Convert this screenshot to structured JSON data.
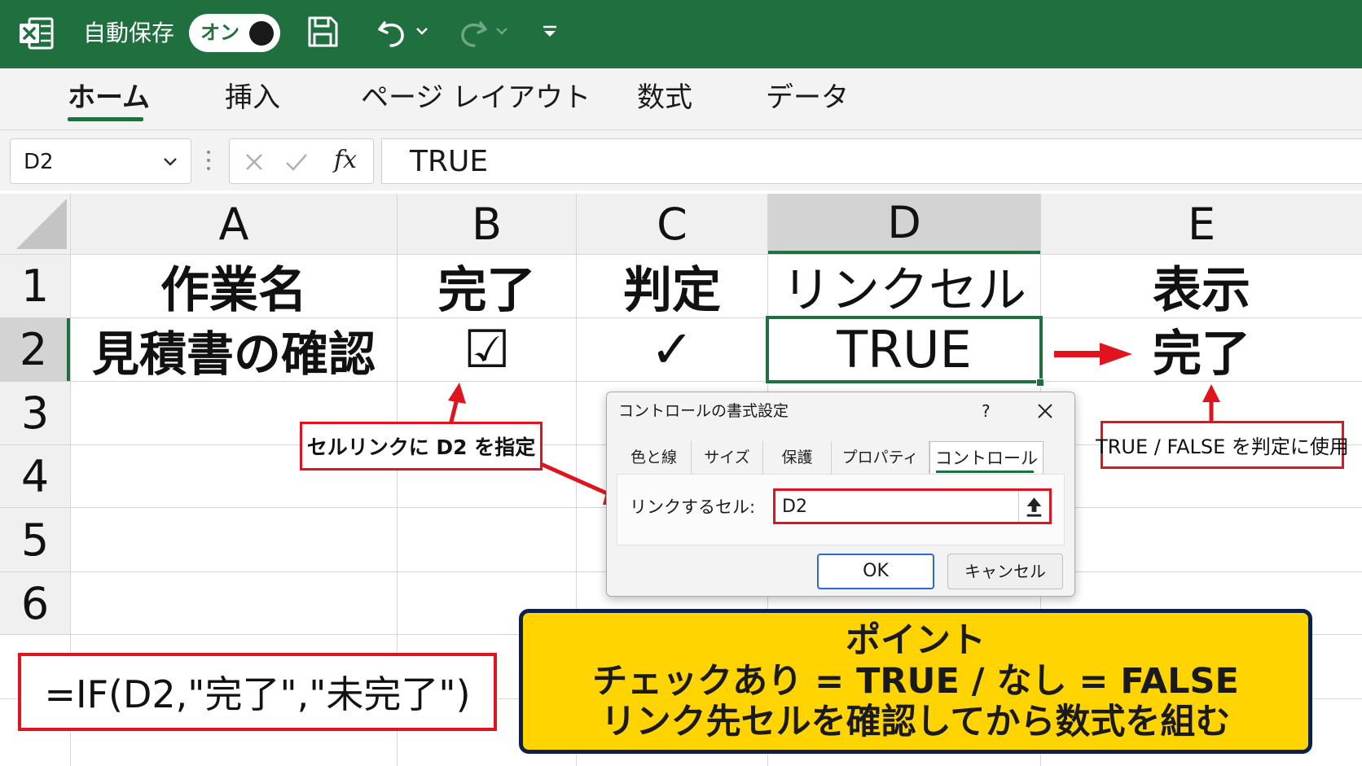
{
  "titlebar": {
    "autosave_label": "自動保存",
    "toggle_state": "オン"
  },
  "ribbon": {
    "tabs": [
      "ホーム",
      "挿入",
      "ページ レイアウト",
      "数式",
      "データ"
    ],
    "active_tab": "ホーム"
  },
  "formula_bar": {
    "name_box": "D2",
    "fx_label": "fx",
    "formula": "TRUE"
  },
  "sheet": {
    "columns": [
      "A",
      "B",
      "C",
      "D",
      "E"
    ],
    "rows": [
      "1",
      "2",
      "3",
      "4",
      "5",
      "6"
    ],
    "selected_column": "D",
    "selected_cell": "D2",
    "cells": {
      "A1": "作業名",
      "B1": "完了",
      "C1": "判定",
      "D1": "リンクセル",
      "E1": "表示",
      "A2": "見積書の確認",
      "B2": "☑",
      "C2": "✓",
      "D2": "TRUE",
      "E2": "完了"
    }
  },
  "callouts": {
    "cell_link": "セルリンクに D2 を指定",
    "true_false": "TRUE / FALSE を判定に使用",
    "formula": "=IF(D2,\"完了\",\"未完了\")"
  },
  "dialog": {
    "title": "コントロールの書式設定",
    "help": "?",
    "tabs": [
      "色と線",
      "サイズ",
      "保護",
      "プロパティ",
      "コントロール"
    ],
    "active_tab": "コントロール",
    "link_label": "リンクするセル:",
    "link_value": "D2",
    "ok_label": "OK",
    "cancel_label": "キャンセル"
  },
  "point": {
    "title": "ポイント",
    "line1": "チェックあり = TRUE / なし = FALSE",
    "line2": "リンク先セルを確認してから数式を組む"
  },
  "colors": {
    "excel_green": "#1f6f3f",
    "callout_red": "#e0141e",
    "point_yellow": "#ffd400",
    "point_border": "#0d1f4d"
  }
}
